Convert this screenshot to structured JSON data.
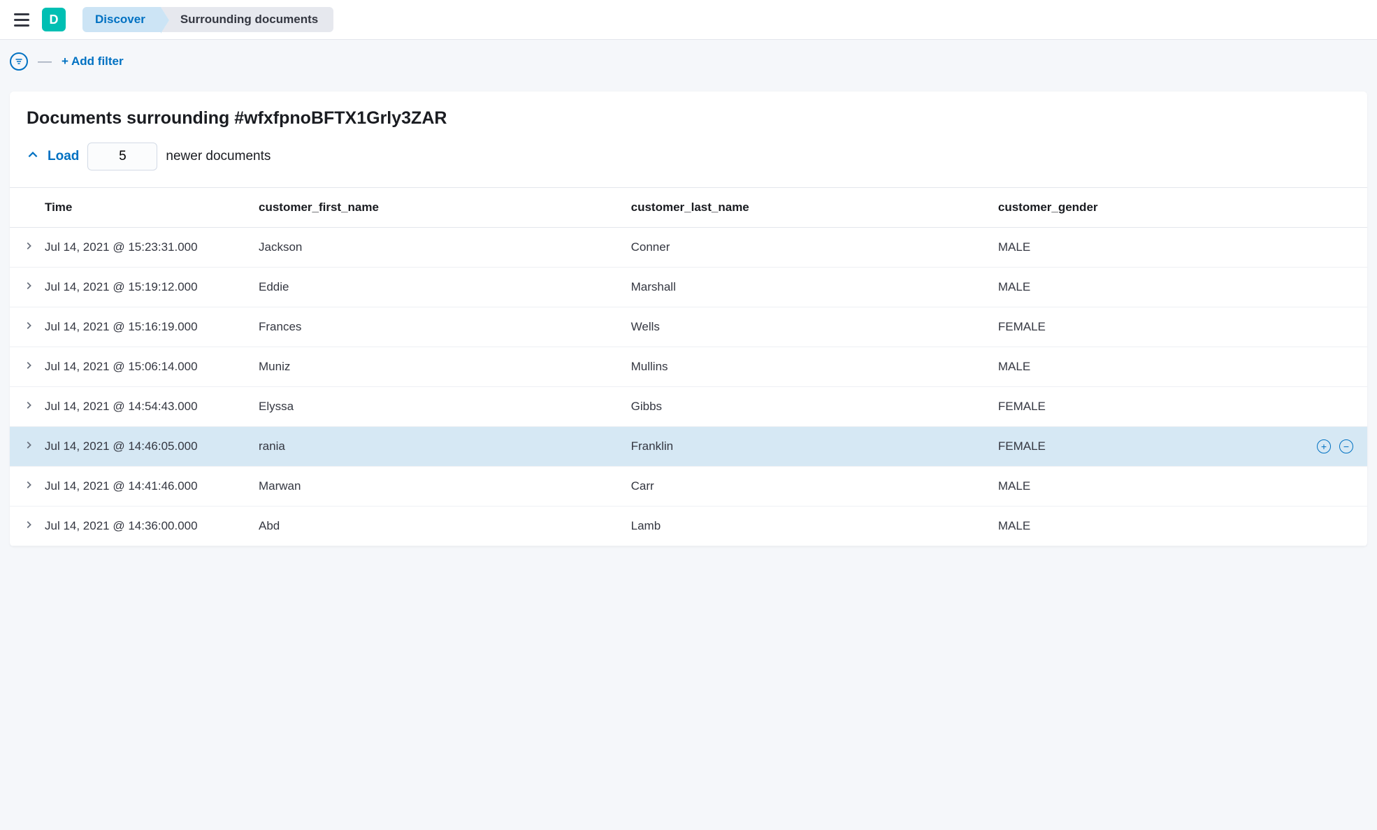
{
  "app_badge": "D",
  "breadcrumb": {
    "items": [
      "Discover",
      "Surrounding documents"
    ]
  },
  "filterbar": {
    "add_filter": "+ Add filter"
  },
  "panel": {
    "title": "Documents surrounding #wfxfpnoBFTX1Grly3ZAR",
    "load": {
      "label": "Load",
      "count": "5",
      "suffix": "newer documents"
    }
  },
  "table": {
    "headers": {
      "time": "Time",
      "first": "customer_first_name",
      "last": "customer_last_name",
      "gender": "customer_gender"
    },
    "rows": [
      {
        "time": "Jul 14, 2021 @ 15:23:31.000",
        "first": "Jackson",
        "last": "Conner",
        "gender": "MALE",
        "highlight": false
      },
      {
        "time": "Jul 14, 2021 @ 15:19:12.000",
        "first": "Eddie",
        "last": "Marshall",
        "gender": "MALE",
        "highlight": false
      },
      {
        "time": "Jul 14, 2021 @ 15:16:19.000",
        "first": "Frances",
        "last": "Wells",
        "gender": "FEMALE",
        "highlight": false
      },
      {
        "time": "Jul 14, 2021 @ 15:06:14.000",
        "first": "Muniz",
        "last": "Mullins",
        "gender": "MALE",
        "highlight": false
      },
      {
        "time": "Jul 14, 2021 @ 14:54:43.000",
        "first": "Elyssa",
        "last": "Gibbs",
        "gender": "FEMALE",
        "highlight": false
      },
      {
        "time": "Jul 14, 2021 @ 14:46:05.000",
        "first": "rania",
        "last": "Franklin",
        "gender": "FEMALE",
        "highlight": true
      },
      {
        "time": "Jul 14, 2021 @ 14:41:46.000",
        "first": "Marwan",
        "last": "Carr",
        "gender": "MALE",
        "highlight": false
      },
      {
        "time": "Jul 14, 2021 @ 14:36:00.000",
        "first": "Abd",
        "last": "Lamb",
        "gender": "MALE",
        "highlight": false
      }
    ]
  }
}
